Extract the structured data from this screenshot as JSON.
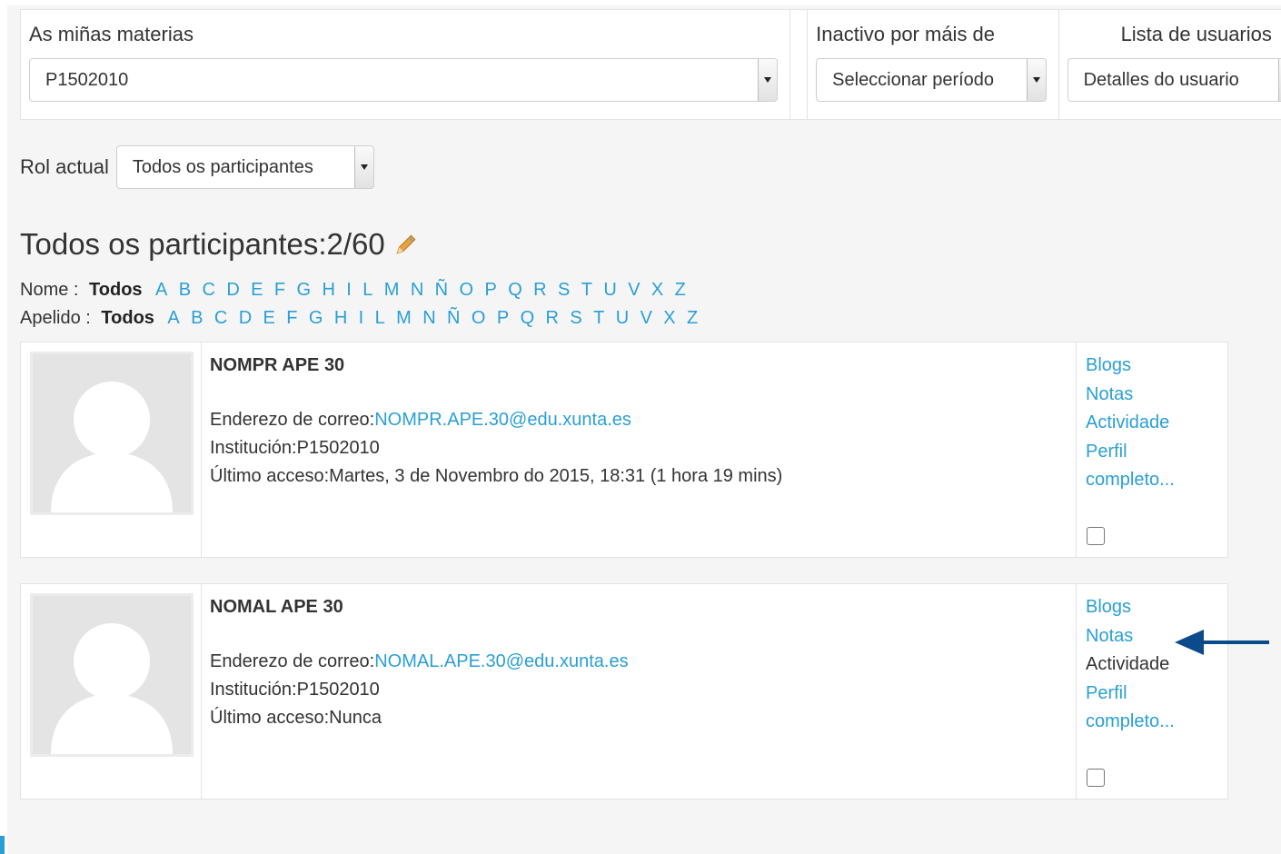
{
  "filters": {
    "courses": {
      "label": "As miñas materias",
      "value": "P1502010"
    },
    "inactive": {
      "label": "Inactivo por máis de",
      "value": "Seleccionar período"
    },
    "userlist": {
      "label": "Lista de usuarios",
      "value": "Detalles do usuario"
    }
  },
  "role": {
    "label": "Rol actual",
    "value": "Todos os participantes"
  },
  "heading": "Todos os participantes:2/60",
  "firstname_filter": {
    "label": "Nome :",
    "all": "Todos",
    "letters": [
      "A",
      "B",
      "C",
      "D",
      "E",
      "F",
      "G",
      "H",
      "I",
      "L",
      "M",
      "N",
      "Ñ",
      "O",
      "P",
      "Q",
      "R",
      "S",
      "T",
      "U",
      "V",
      "X",
      "Z"
    ]
  },
  "lastname_filter": {
    "label": "Apelido :",
    "all": "Todos",
    "letters": [
      "A",
      "B",
      "C",
      "D",
      "E",
      "F",
      "G",
      "H",
      "I",
      "L",
      "M",
      "N",
      "Ñ",
      "O",
      "P",
      "Q",
      "R",
      "S",
      "T",
      "U",
      "V",
      "X",
      "Z"
    ]
  },
  "participants": [
    {
      "name": "NOMPR APE 30",
      "email_label": "Enderezo de correo:",
      "email": "NOMPR.APE.30@edu.xunta.es",
      "institution": "Institución:P1502010",
      "last_access": "Último acceso:Martes, 3 de Novembro do 2015, 18:31  (1 hora 19 mins)",
      "links": [
        "Blogs",
        "Notas",
        "Actividade",
        "Perfil",
        "completo..."
      ]
    },
    {
      "name": "NOMAL APE 30",
      "email_label": "Enderezo de correo:",
      "email": "NOMAL.APE.30@edu.xunta.es",
      "institution": "Institución:P1502010",
      "last_access": "Último acceso:Nunca",
      "links": [
        "Blogs",
        "Notas",
        "Actividade",
        "Perfil",
        "completo..."
      ]
    }
  ],
  "colors": {
    "link": "#2a9fd6",
    "annotation_arrow": "#0b4a8b"
  }
}
